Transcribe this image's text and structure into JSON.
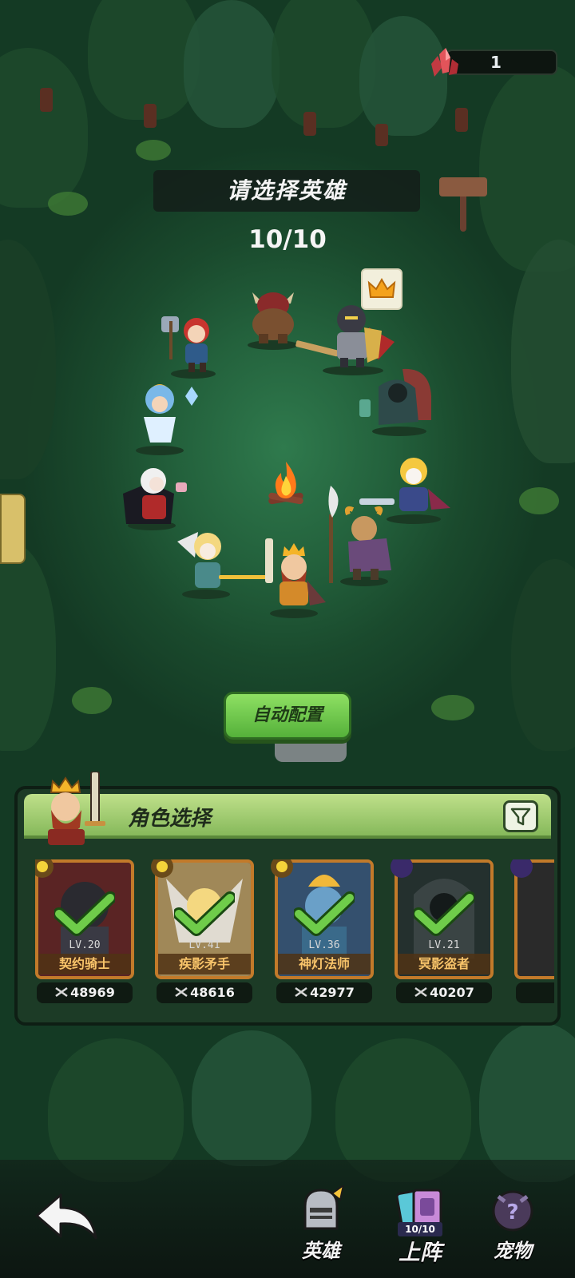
{
  "resource": {
    "icon": "red-crystal-icon",
    "count": "1"
  },
  "header": {
    "title": "请选择英雄",
    "counter": "10/10"
  },
  "auto_button": {
    "label": "自动配置"
  },
  "roster": {
    "title": "角色选择",
    "filter_icon": "filter-icon",
    "cards": [
      {
        "level": "LV.20",
        "name": "契约骑士",
        "power": "48969",
        "element": "sun",
        "selected": true,
        "art_color": "#7a2624"
      },
      {
        "level": "LV.41",
        "name": "疾影矛手",
        "power": "48616",
        "element": "sun",
        "selected": true,
        "art_color": "#9a7a50"
      },
      {
        "level": "LV.36",
        "name": "神灯法师",
        "power": "42977",
        "element": "sun",
        "selected": true,
        "art_color": "#3b5a7a"
      },
      {
        "level": "LV.21",
        "name": "冥影盗者",
        "power": "40207",
        "element": "moon",
        "selected": true,
        "art_color": "#2e3a3a"
      }
    ]
  },
  "nav": {
    "back_icon": "back-arrow-icon",
    "items": [
      {
        "label": "英雄",
        "icon": "knight-helmet-icon"
      },
      {
        "label": "上阵",
        "icon": "deck-cards-icon",
        "badge": "10/10"
      },
      {
        "label": "宠物",
        "icon": "pet-egg-icon"
      }
    ]
  },
  "colors": {
    "accent_green": "#6fcc4a",
    "card_border": "#c27a2a",
    "panel_header": "#a8d074"
  }
}
